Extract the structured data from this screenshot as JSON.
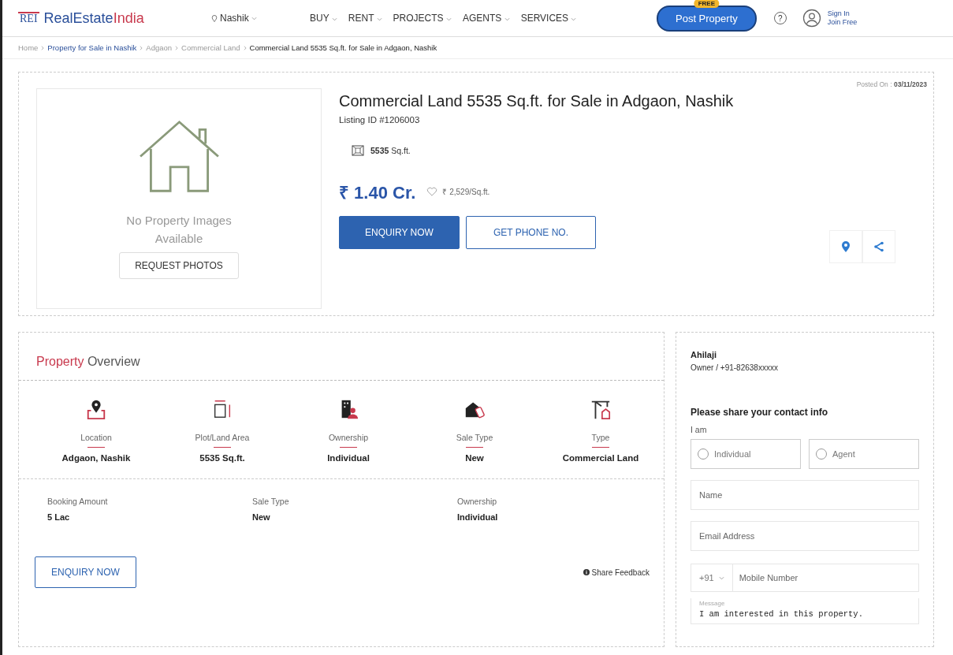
{
  "header": {
    "logo_mark": "REI",
    "logo_text_a": "RealEstate",
    "logo_text_b": "India",
    "city": "Nashik",
    "nav": [
      {
        "label": "BUY"
      },
      {
        "label": "RENT"
      },
      {
        "label": "PROJECTS"
      },
      {
        "label": "AGENTS"
      },
      {
        "label": "SERVICES"
      }
    ],
    "post_button": "Post Property",
    "post_badge": "FREE",
    "help": "?",
    "sign_in": "Sign In",
    "join": "Join Free"
  },
  "breadcrumb": [
    {
      "label": "Home",
      "kind": "muted"
    },
    {
      "label": "Property for Sale in Nashik",
      "kind": "link"
    },
    {
      "label": "Adgaon",
      "kind": "muted"
    },
    {
      "label": "Commercial Land",
      "kind": "muted"
    },
    {
      "label": "Commercial Land 5535 Sq.ft. for Sale in Adgaon, Nashik",
      "kind": "current"
    }
  ],
  "listing": {
    "no_images": "No Property Images Available",
    "request_photos": "REQUEST PHOTOS",
    "posted_label": "Posted On :",
    "posted_date": "03/11/2023",
    "title": "Commercial Land 5535 Sq.ft. for Sale in Adgaon, Nashik",
    "listing_id": "Listing ID #1206003",
    "area_value": "5535",
    "area_unit": "Sq.ft.",
    "price": "₹ 1.40 Cr.",
    "rate": "₹ 2,529/Sq.ft.",
    "enquiry": "ENQUIRY NOW",
    "phone": "GET PHONE NO."
  },
  "overview": {
    "title_a": "Property",
    "title_b": "Overview",
    "highlights": [
      {
        "kind": "location",
        "label": "Location",
        "value": "Adgaon, Nashik"
      },
      {
        "kind": "area",
        "label": "Plot/Land Area",
        "value": "5535 Sq.ft."
      },
      {
        "kind": "ownership",
        "label": "Ownership",
        "value": "Individual"
      },
      {
        "kind": "sale",
        "label": "Sale Type",
        "value": "New"
      },
      {
        "kind": "type",
        "label": "Type",
        "value": "Commercial Land"
      }
    ],
    "details": [
      {
        "label": "Booking Amount",
        "value": "5 Lac"
      },
      {
        "label": "Sale Type",
        "value": "New"
      },
      {
        "label": "Ownership",
        "value": "Individual"
      }
    ],
    "enquiry": "ENQUIRY NOW",
    "feedback": "Share Feedback"
  },
  "contact": {
    "name": "Ahilaji",
    "role": "Owner / +91-82638xxxxx",
    "prompt": "Please share your contact info",
    "i_am": "I am",
    "roles": [
      {
        "label": "Individual",
        "selected": false
      },
      {
        "label": "Agent",
        "selected": false
      }
    ],
    "name_placeholder": "Name",
    "email_placeholder": "Email Address",
    "code": "+91",
    "mobile_placeholder": "Mobile Number",
    "message_label": "Message",
    "message": "I am interested in this property."
  }
}
